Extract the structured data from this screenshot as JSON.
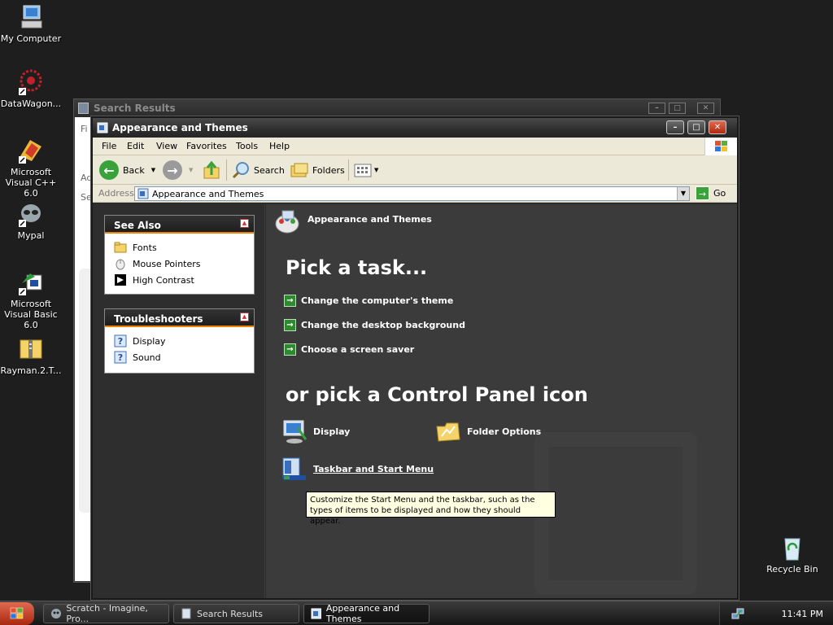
{
  "desktop": {
    "icons": [
      {
        "label": "My Computer"
      },
      {
        "label": "DataWagon..."
      },
      {
        "label": "Microsoft Visual C++ 6.0"
      },
      {
        "label": "Mypal"
      },
      {
        "label": "Microsoft Visual Basic 6.0"
      },
      {
        "label": "Rayman.2.T..."
      },
      {
        "label": "Recycle Bin"
      }
    ]
  },
  "bg_window": {
    "title": "Search Results",
    "frag_menu": "Fi",
    "frag_addr": "Ad",
    "frag_search": "Se"
  },
  "window": {
    "title": "Appearance and Themes",
    "controls": {
      "minimize": "–",
      "maximize": "□",
      "close": "✕"
    }
  },
  "menubar": [
    "File",
    "Edit",
    "View",
    "Favorites",
    "Tools",
    "Help"
  ],
  "toolbar": {
    "back": "Back",
    "search": "Search",
    "folders": "Folders"
  },
  "address": {
    "label": "Address",
    "value": "Appearance and Themes",
    "go": "Go"
  },
  "see_also": {
    "title": "See Also",
    "items": [
      "Fonts",
      "Mouse Pointers",
      "High Contrast"
    ]
  },
  "troubleshooters": {
    "title": "Troubleshooters",
    "items": [
      "Display",
      "Sound"
    ]
  },
  "main": {
    "header": "Appearance and Themes",
    "pick_task": "Pick a task...",
    "tasks": [
      "Change the computer's theme",
      "Change the desktop background",
      "Choose a screen saver"
    ],
    "pick_icon": "or pick a Control Panel icon",
    "icons": [
      "Display",
      "Folder Options",
      "Taskbar and Start Menu"
    ],
    "tooltip": "Customize the Start Menu and the taskbar, such as the types of items to be displayed and how they should appear."
  },
  "taskbar": {
    "buttons": [
      "Scratch - Imagine, Pro...",
      "Search Results",
      "Appearance and Themes"
    ],
    "active_index": 2,
    "clock": "11:41 PM"
  },
  "colors": {
    "accent_orange": "#f08000",
    "task_green": "#2d8a2d",
    "start_red": "#c33a1c"
  }
}
